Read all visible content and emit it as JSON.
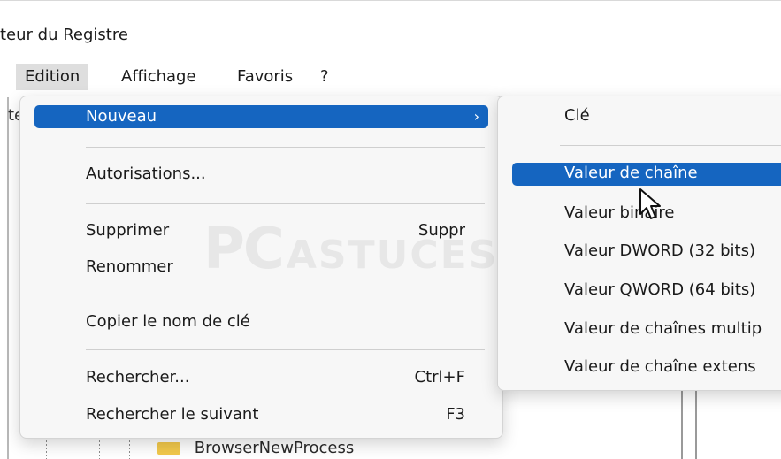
{
  "window": {
    "title": "teur du Registre"
  },
  "menubar": {
    "items": [
      "Edition",
      "Affichage",
      "Favoris",
      "?"
    ]
  },
  "tree": {
    "left_fragment": "te",
    "visible_folder": "BrowserNewProcess"
  },
  "edition_menu": {
    "items": [
      {
        "label": "Nouveau",
        "shortcut": "",
        "submenu": true
      },
      {
        "label": "Autorisations...",
        "shortcut": ""
      },
      {
        "label": "Supprimer",
        "shortcut": "Suppr"
      },
      {
        "label": "Renommer",
        "shortcut": ""
      },
      {
        "label": "Copier le nom de clé",
        "shortcut": ""
      },
      {
        "label": "Rechercher...",
        "shortcut": "Ctrl+F"
      },
      {
        "label": "Rechercher le suivant",
        "shortcut": "F3"
      }
    ]
  },
  "submenu": {
    "items": [
      {
        "label": "Clé"
      },
      {
        "label": "Valeur de chaîne"
      },
      {
        "label": "Valeur binaire"
      },
      {
        "label": "Valeur DWORD (32 bits)"
      },
      {
        "label": "Valeur QWORD (64 bits)"
      },
      {
        "label": "Valeur de chaînes multip"
      },
      {
        "label": "Valeur de chaîne extens"
      }
    ]
  },
  "watermark": {
    "primary": "PC",
    "secondary": "ASTUCES"
  },
  "colors": {
    "highlight": "#1565c0",
    "menu_bg": "#f7f7f7"
  }
}
